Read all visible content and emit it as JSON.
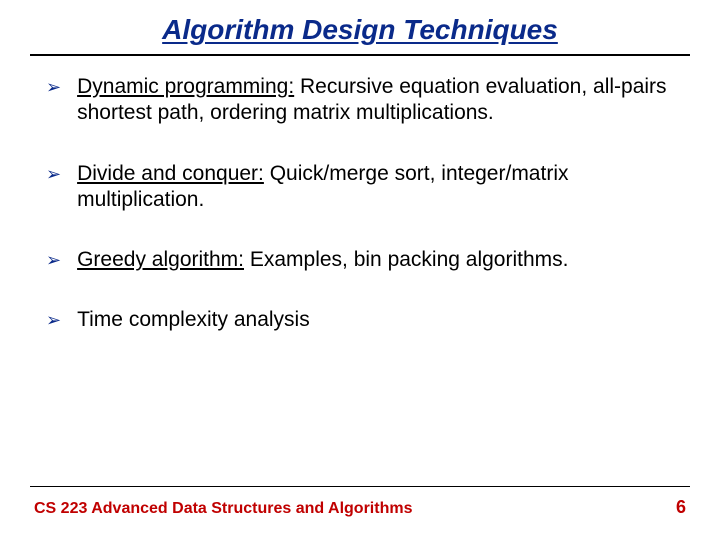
{
  "title": "Algorithm Design Techniques",
  "bullets": [
    {
      "topic": "Dynamic programming:",
      "rest": " Recursive equation evaluation, all-pairs shortest path, ordering matrix multiplications."
    },
    {
      "topic": "Divide and conquer:",
      "rest": " Quick/merge sort, integer/matrix multiplication."
    },
    {
      "topic": "Greedy algorithm:",
      "rest": " Examples, bin packing algorithms."
    },
    {
      "topic": "",
      "rest": " Time complexity analysis"
    }
  ],
  "footer": {
    "course": "CS 223 Advanced Data Structures and Algorithms",
    "page": "6"
  },
  "glyphs": {
    "arrow": "➢"
  }
}
